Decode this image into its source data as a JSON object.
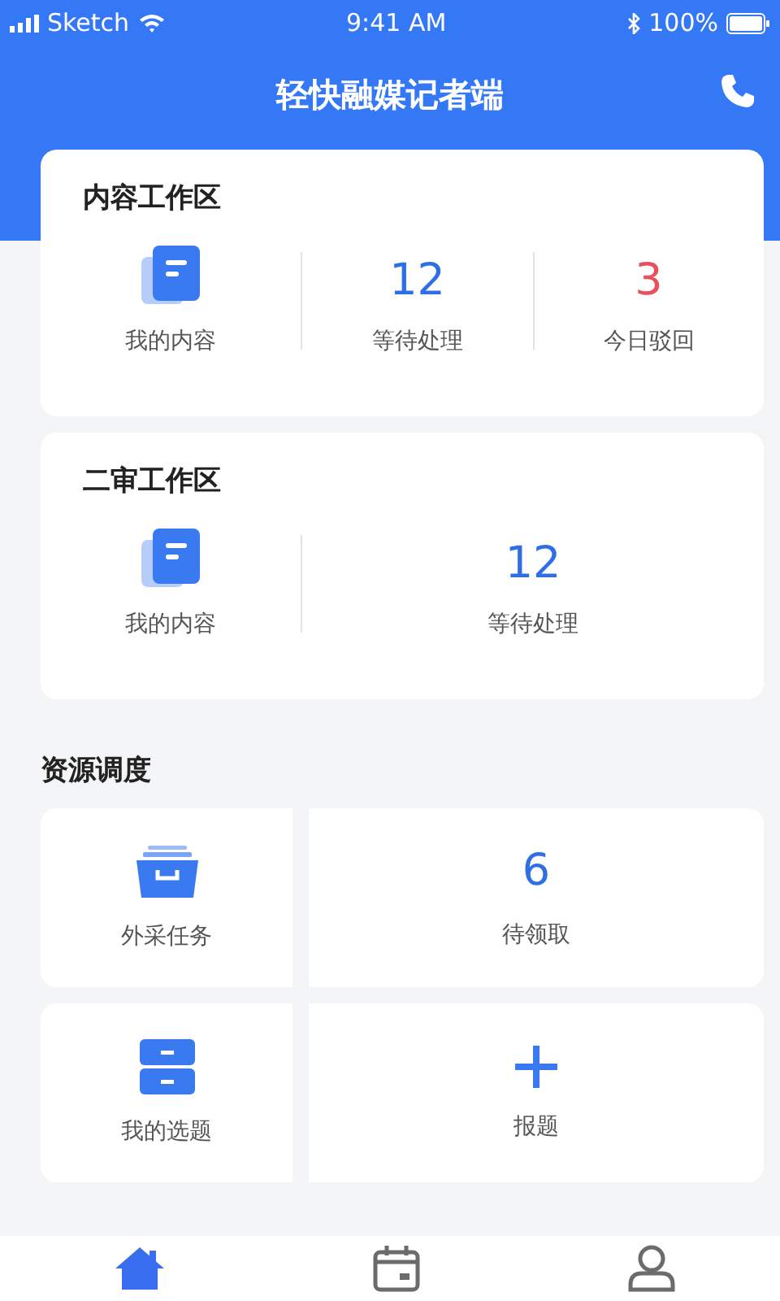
{
  "status_bar": {
    "carrier": "Sketch",
    "time": "9:41 AM",
    "battery": "100%"
  },
  "header": {
    "title": "轻快融媒记者端"
  },
  "workspaces": [
    {
      "title": "内容工作区",
      "items": [
        {
          "kind": "document",
          "label": "我的内容"
        },
        {
          "kind": "count",
          "value": "12",
          "label": "等待处理",
          "color": "#2f6fe4"
        },
        {
          "kind": "count",
          "value": "3",
          "label": "今日驳回",
          "color": "#e8505b"
        }
      ]
    },
    {
      "title": "二审工作区",
      "items": [
        {
          "kind": "document",
          "label": "我的内容"
        },
        {
          "kind": "count",
          "value": "12",
          "label": "等待处理",
          "color": "#2f6fe4"
        }
      ]
    }
  ],
  "resources": {
    "title": "资源调度",
    "rows": [
      [
        {
          "kind": "tray",
          "label": "外采任务"
        },
        {
          "kind": "count",
          "value": "6",
          "label": "待领取",
          "color": "#2f6fe4"
        }
      ],
      [
        {
          "kind": "cabinet",
          "label": "我的选题"
        },
        {
          "kind": "add",
          "label": "报题"
        }
      ]
    ]
  },
  "tab_bar": [
    {
      "kind": "home",
      "selected": true
    },
    {
      "kind": "calendar",
      "selected": false
    },
    {
      "kind": "profile",
      "selected": false
    }
  ]
}
